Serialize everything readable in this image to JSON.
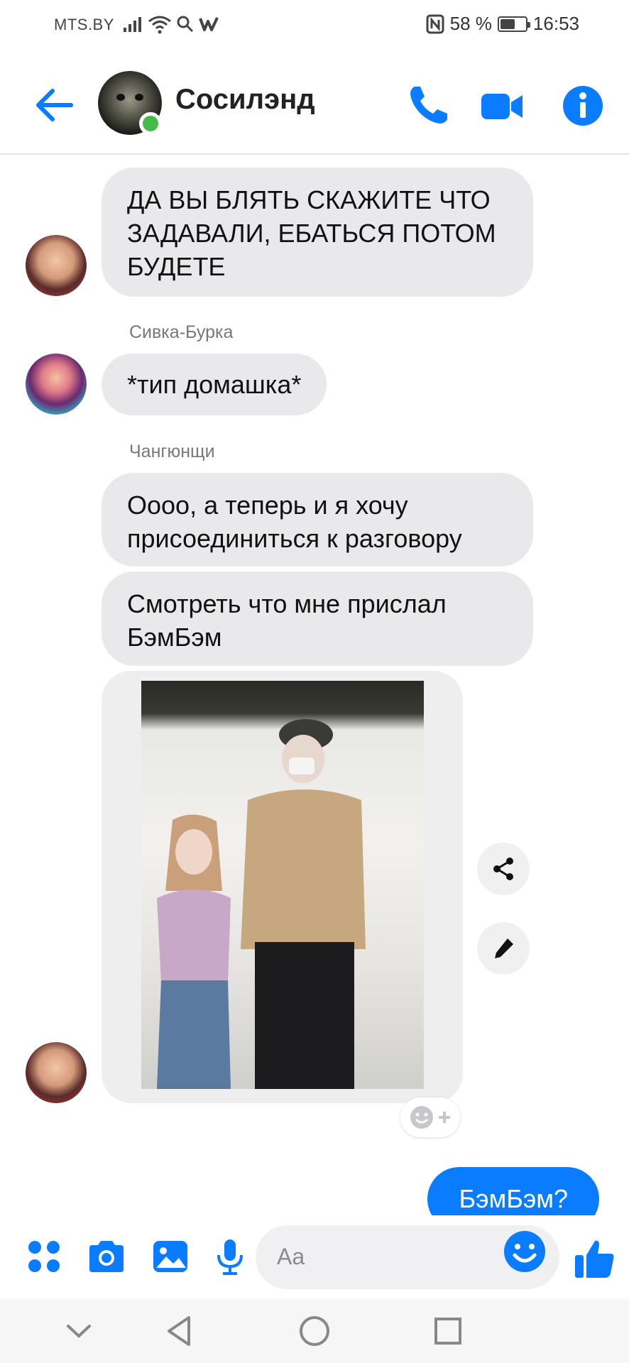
{
  "status_bar": {
    "carrier": "MTS.BY",
    "battery_percent": "58 %",
    "battery_level": 0.58,
    "time": "16:53"
  },
  "header": {
    "chat_title": "Сосилэнд",
    "online": true,
    "back_icon": "back-arrow-icon",
    "call_icon": "phone-icon",
    "video_icon": "video-camera-icon",
    "info_icon": "info-icon",
    "accent_color": "#0a7cff"
  },
  "messages": {
    "msg1_text": "ДА ВЫ БЛЯТЬ СКАЖИТЕ ЧТО ЗАДАВАЛИ, ЕБАТЬСЯ ПОТОМ БУДЕТЕ",
    "sender2": "Сивка-Бурка",
    "msg2_text": "*тип домашка*",
    "sender3": "Чангюнщи",
    "msg3_text": "Оооо, а теперь и я хочу присоединиться к разговору",
    "msg4_text": "Смотреть что мне прислал БэмБэм",
    "outgoing_text": "БэмБэм?"
  },
  "composer": {
    "placeholder": "Aa",
    "icons": [
      "apps-icon",
      "camera-icon",
      "gallery-icon",
      "microphone-icon",
      "emoji-icon",
      "thumbs-up-icon"
    ]
  },
  "nav_bar": {
    "icons": [
      "collapse-icon",
      "back-triangle-icon",
      "home-circle-icon",
      "recents-square-icon"
    ]
  }
}
